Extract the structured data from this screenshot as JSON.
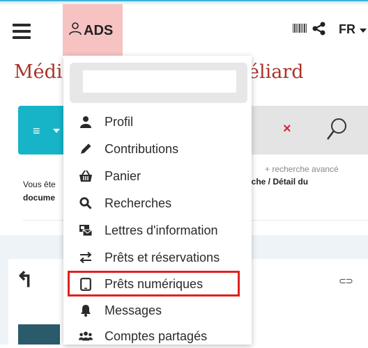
{
  "header": {
    "ads_label": "ADS",
    "lang_label": "FR",
    "icons": [
      "menu-icon",
      "user-icon",
      "barcode-icon",
      "share-icon",
      "caret-down-icon"
    ]
  },
  "page": {
    "title_left": "Médi",
    "title_right": "éliard",
    "advanced_search": "+ recherche avancé",
    "breadcrumb_line1": "Vous ête",
    "breadcrumb_line2": "docume",
    "breadcrumb_right": "rche / Détail du",
    "clear_symbol": "×"
  },
  "dropdown": {
    "search_value": "",
    "items": [
      {
        "label": "Profil",
        "icon": "user-icon"
      },
      {
        "label": "Contributions",
        "icon": "pencil-icon"
      },
      {
        "label": "Panier",
        "icon": "basket-icon"
      },
      {
        "label": "Recherches",
        "icon": "search-icon"
      },
      {
        "label": "Lettres d'information",
        "icon": "newsletter-icon"
      },
      {
        "label": "Prêts et réservations",
        "icon": "exchange-icon"
      },
      {
        "label": "Prêts numériques",
        "icon": "tablet-icon",
        "highlighted": true
      },
      {
        "label": "Messages",
        "icon": "bell-icon"
      },
      {
        "label": "Comptes partagés",
        "icon": "users-icon"
      }
    ]
  },
  "colors": {
    "accent_teal": "#17b4c8",
    "title_red": "#a8342a",
    "ads_bg": "#f7c2c2",
    "highlight_red": "#e02020"
  }
}
